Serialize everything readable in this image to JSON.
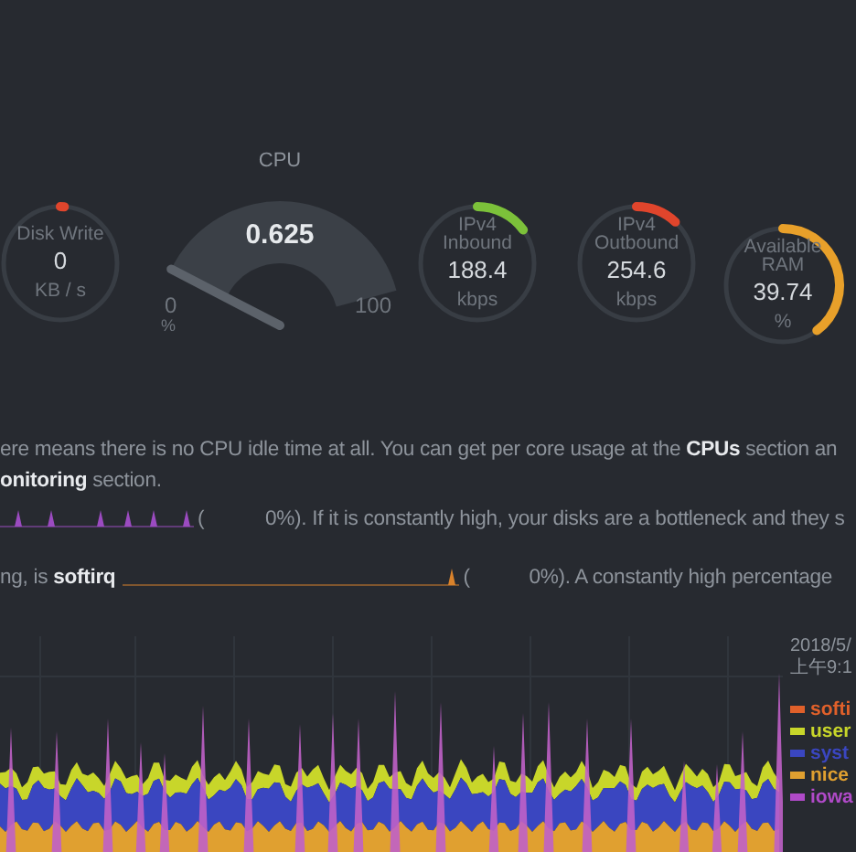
{
  "gauges": [
    {
      "kind": "dial",
      "title_lines": [
        "Disk Write"
      ],
      "value": "0",
      "unit": "KB / s",
      "color": "#e0452c"
    },
    {
      "kind": "half",
      "title": "CPU",
      "value": "0.625",
      "min": "0",
      "max": "100",
      "unit": "%"
    },
    {
      "kind": "dial",
      "title_lines": [
        "IPv4",
        "Inbound"
      ],
      "value": "188.4",
      "unit": "kbps",
      "color": "#7cc13a"
    },
    {
      "kind": "dial",
      "title_lines": [
        "IPv4",
        "Outbound"
      ],
      "value": "254.6",
      "unit": "kbps",
      "color": "#e0452c"
    },
    {
      "kind": "dial",
      "title_lines": [
        "Available",
        "RAM"
      ],
      "value": "39.74",
      "unit": "%",
      "color": "#e8a02a"
    }
  ],
  "notes": [
    {
      "kind": "text",
      "text": "ere means there is no CPU idle time at all. You can get per core usage at the **CPUs** section an"
    },
    {
      "kind": "text",
      "text": "**onitoring** section."
    },
    {
      "kind": "spark",
      "color": "#9b4bc0",
      "open": "(",
      "text": "0%). If it is constantly high, your disks are a bottleneck and they s"
    },
    {
      "kind": "spark",
      "lead": "ng, is **softirq**",
      "color": "#d9822b",
      "open": "(",
      "text": "0%). A constantly high percentage"
    }
  ],
  "chart": {
    "timestamp_lines": [
      "2018/5/",
      "上午9:1"
    ],
    "legend": [
      {
        "label": "softi",
        "color": "#e0602a"
      },
      {
        "label": "user",
        "color": "#c8d62a"
      },
      {
        "label": "syst",
        "color": "#3a46c0"
      },
      {
        "label": "nice",
        "color": "#e0a030"
      },
      {
        "label": "iowa",
        "color": "#b04ac8"
      }
    ]
  }
}
